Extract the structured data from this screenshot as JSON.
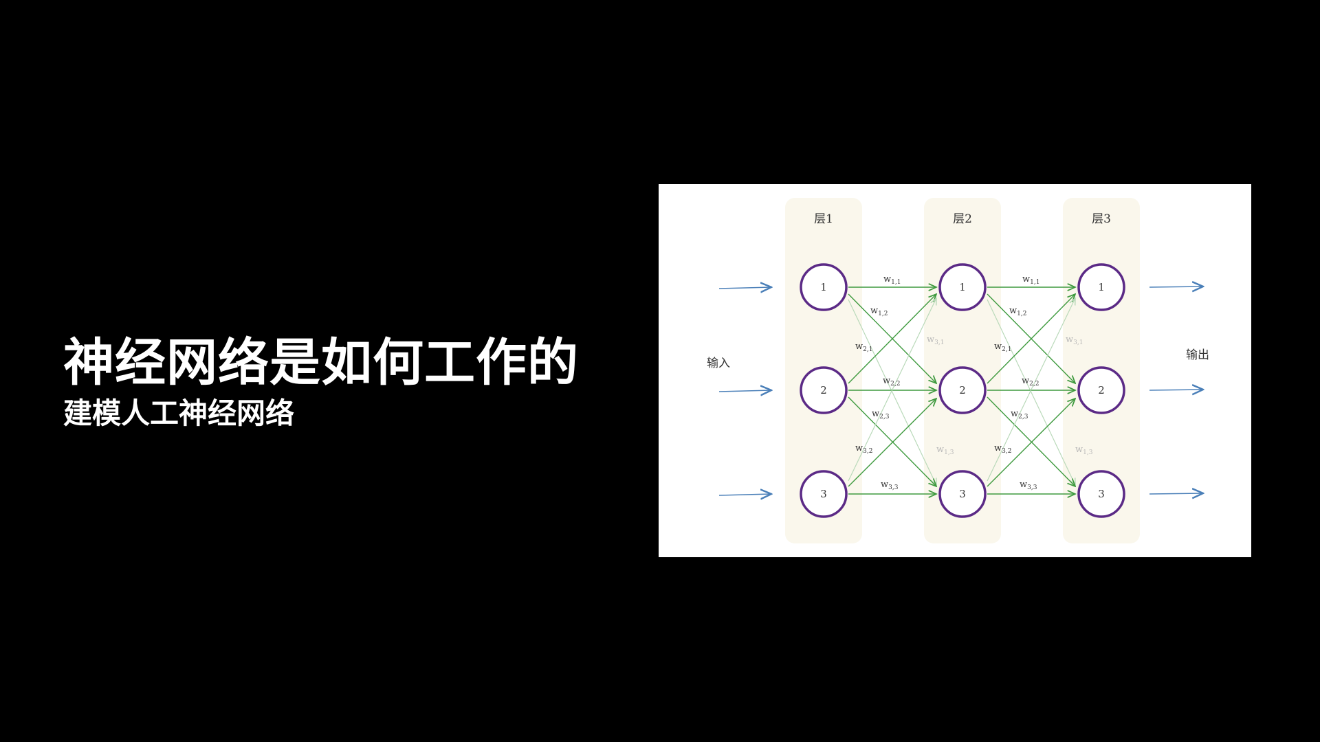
{
  "slide": {
    "title": "神经网络是如何工作的",
    "subtitle": "建模人工神经网络"
  },
  "diagram": {
    "layers": [
      "层1",
      "层2",
      "层3"
    ],
    "input_label": "输入",
    "output_label": "输出",
    "node_labels": [
      "1",
      "2",
      "3"
    ],
    "weights_l1_l2": [
      "1,1",
      "1,2",
      "2,1",
      "3,1",
      "2,2",
      "2,3",
      "1,3",
      "3,2",
      "3,3"
    ],
    "weights_l2_l3": [
      "1,1",
      "1,2",
      "2,1",
      "3,1",
      "2,2",
      "2,3",
      "1,3",
      "3,2",
      "3,3"
    ],
    "colors": {
      "background": "#000000",
      "layer_panel": "#faf7ec",
      "node_stroke": "#5b2a86",
      "weight_arrow": "#3e9a3e",
      "faint_arrow": "#b9d9b9",
      "io_arrow": "#4a7fb8"
    }
  }
}
